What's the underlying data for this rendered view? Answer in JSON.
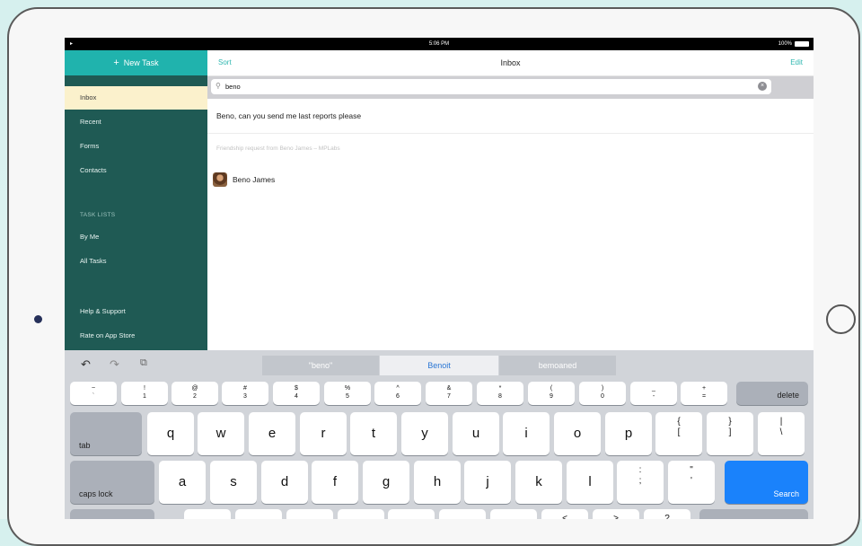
{
  "status_bar": {
    "carrier_icon": "signal-icon",
    "time": "5:06 PM",
    "battery": "100%"
  },
  "sidebar": {
    "new_task": "New Task",
    "items": [
      {
        "label": "Inbox",
        "selected": true
      },
      {
        "label": "Recent"
      },
      {
        "label": "Forms"
      },
      {
        "label": "Contacts"
      }
    ],
    "task_lists_heading": "TASK LISTS",
    "task_lists": [
      {
        "label": "By Me"
      },
      {
        "label": "All Tasks"
      }
    ],
    "footer": [
      {
        "label": "Help & Support"
      },
      {
        "label": "Rate on App Store"
      }
    ]
  },
  "header": {
    "sort": "Sort",
    "title": "Inbox",
    "edit": "Edit"
  },
  "search": {
    "value": "beno",
    "clear_icon": "clear-icon"
  },
  "results": {
    "task": "Beno, can you send me last reports please",
    "note": "Friendship request from Beno James – MPLabs",
    "contact": {
      "name": "Beno James"
    }
  },
  "keyboard": {
    "suggestions": [
      "\"beno\"",
      "Benoit",
      "bemoaned"
    ],
    "row_numbers": [
      [
        "~",
        "`"
      ],
      [
        "!",
        "1"
      ],
      [
        "@",
        "2"
      ],
      [
        "#",
        "3"
      ],
      [
        "$",
        "4"
      ],
      [
        "%",
        "5"
      ],
      [
        "^",
        "6"
      ],
      [
        "&",
        "7"
      ],
      [
        "*",
        "8"
      ],
      [
        "(",
        "9"
      ],
      [
        ")",
        "0"
      ],
      [
        "_",
        "-"
      ],
      [
        "+",
        "="
      ]
    ],
    "delete": "delete",
    "row_q": [
      "q",
      "w",
      "e",
      "r",
      "t",
      "y",
      "u",
      "i",
      "o",
      "p"
    ],
    "row_q_sym": [
      [
        "{",
        "["
      ],
      [
        "}",
        "]"
      ],
      [
        "|",
        "\\"
      ]
    ],
    "tab": "tab",
    "row_a": [
      "a",
      "s",
      "d",
      "f",
      "g",
      "h",
      "j",
      "k",
      "l"
    ],
    "row_a_sym": [
      [
        ":",
        ";"
      ],
      [
        "\"",
        "'"
      ]
    ],
    "caps_lock": "caps lock",
    "search_key": "Search",
    "row_z_sym": [
      [
        "<",
        ","
      ],
      [
        ">",
        "."
      ],
      [
        "?",
        "/"
      ]
    ],
    "accent_color": "#1a82fb"
  },
  "colors": {
    "brand": "#20b3ad",
    "sidebar": "#1f5a54",
    "selected": "#fbf1cc"
  }
}
